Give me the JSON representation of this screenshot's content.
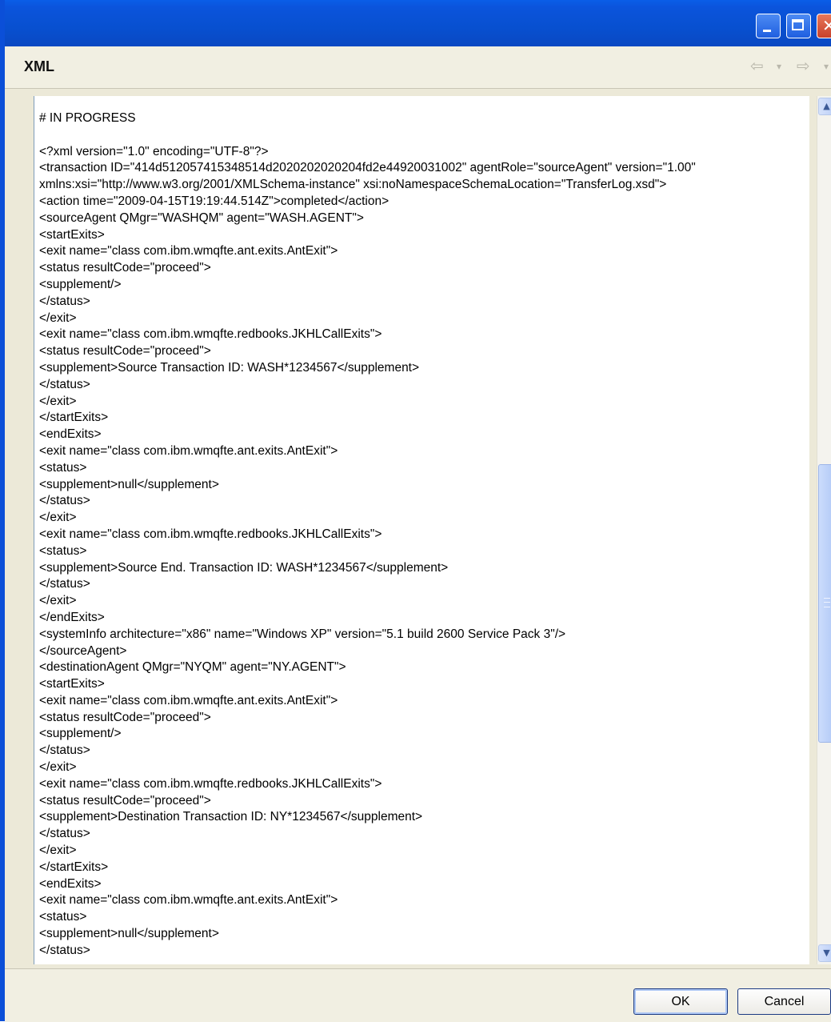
{
  "dialog": {
    "title": "XML",
    "buttons": {
      "ok": "OK",
      "cancel": "Cancel"
    }
  },
  "window_controls": {
    "close_glyph": "✕"
  },
  "navigation": {
    "back_glyph": "⇦",
    "forward_glyph": "⇨",
    "dropdown_glyph": "▾"
  },
  "scrollbar": {
    "up_glyph": "▲",
    "down_glyph": "▼"
  },
  "xml_lines": [
    "# IN PROGRESS",
    "",
    "<?xml version=\"1.0\" encoding=\"UTF-8\"?>",
    "<transaction ID=\"414d512057415348514d2020202020204fd2e44920031002\" agentRole=\"sourceAgent\" version=\"1.00\"",
    "xmlns:xsi=\"http://www.w3.org/2001/XMLSchema-instance\" xsi:noNamespaceSchemaLocation=\"TransferLog.xsd\">",
    "<action time=\"2009-04-15T19:19:44.514Z\">completed</action>",
    "<sourceAgent QMgr=\"WASHQM\" agent=\"WASH.AGENT\">",
    "<startExits>",
    "<exit name=\"class com.ibm.wmqfte.ant.exits.AntExit\">",
    "<status resultCode=\"proceed\">",
    "<supplement/>",
    "</status>",
    "</exit>",
    "<exit name=\"class com.ibm.wmqfte.redbooks.JKHLCallExits\">",
    "<status resultCode=\"proceed\">",
    "<supplement>Source Transaction ID: WASH*1234567</supplement>",
    "</status>",
    "</exit>",
    "</startExits>",
    "<endExits>",
    "<exit name=\"class com.ibm.wmqfte.ant.exits.AntExit\">",
    "<status>",
    "<supplement>null</supplement>",
    "</status>",
    "</exit>",
    "<exit name=\"class com.ibm.wmqfte.redbooks.JKHLCallExits\">",
    "<status>",
    "<supplement>Source End. Transaction ID: WASH*1234567</supplement>",
    "</status>",
    "</exit>",
    "</endExits>",
    "<systemInfo architecture=\"x86\" name=\"Windows XP\" version=\"5.1 build 2600 Service Pack 3\"/>",
    "</sourceAgent>",
    "<destinationAgent QMgr=\"NYQM\" agent=\"NY.AGENT\">",
    "<startExits>",
    "<exit name=\"class com.ibm.wmqfte.ant.exits.AntExit\">",
    "<status resultCode=\"proceed\">",
    "<supplement/>",
    "</status>",
    "</exit>",
    "<exit name=\"class com.ibm.wmqfte.redbooks.JKHLCallExits\">",
    "<status resultCode=\"proceed\">",
    "<supplement>Destination Transaction ID: NY*1234567</supplement>",
    "</status>",
    "</exit>",
    "</startExits>",
    "<endExits>",
    "<exit name=\"class com.ibm.wmqfte.ant.exits.AntExit\">",
    "<status>",
    "<supplement>null</supplement>",
    "</status>"
  ]
}
